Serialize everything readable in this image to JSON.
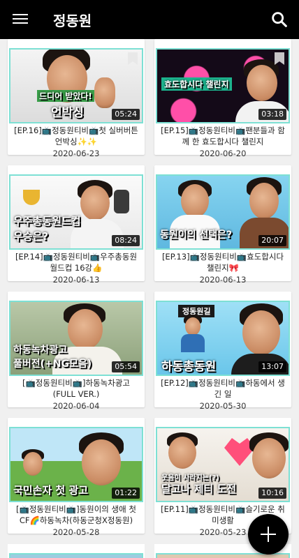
{
  "app": {
    "title": "정동원"
  },
  "videos": [
    {
      "title": "[EP.16]📺정동원티비📺첫 실버버튼 언박싱✨✨",
      "date": "2020-06-23",
      "duration": "05:24",
      "caption_top": "드디어 받았다!",
      "caption_main": "언박싱"
    },
    {
      "title": "[EP.15]📺정동원티비📺팬분들과 함께 한 효도합시다 챌린지",
      "date": "2020-06-20",
      "duration": "03:18",
      "caption_top": "효도합시다 챌린지",
      "caption_main": ""
    },
    {
      "title": "[EP.14]📺정동원티비📺우주총동원 월드컵 16강👍",
      "date": "2020-06-13",
      "duration": "08:24",
      "caption_top": "우주총동원드컵",
      "caption_main": "우승은?"
    },
    {
      "title": "[EP.13]📺정동원티비📺효도합시다 챌린지🎀",
      "date": "2020-06-13",
      "duration": "20:07",
      "caption_top": "",
      "caption_main": "동원이의 선택은?"
    },
    {
      "title": "[📺정동원티비📺]하동녹차광고(FULL VER.)",
      "date": "2020-06-04",
      "duration": "05:54",
      "caption_top": "하동녹차광고",
      "caption_main": "풀버전(+NG모음)"
    },
    {
      "title": "[EP.12]📺정동원티비📺하동에서 생긴 일",
      "date": "2020-05-30",
      "duration": "13:07",
      "caption_top": "정동원길",
      "caption_main": "하동총동원"
    },
    {
      "title": "[📺정동원티비📺]동원이의 생애 첫 CF🌈하동녹차(하동군청X정동원)",
      "date": "2020-05-28",
      "duration": "01:22",
      "caption_top": "",
      "caption_main": "국민손자 첫 광고"
    },
    {
      "title": "[EP.11]📺정동원티비📺슬기로운 취미생활",
      "date": "2020-05-23",
      "duration": "10:16",
      "caption_top": "웃음이 사라지는(?)",
      "caption_main": "달고나 제티 도전"
    }
  ]
}
